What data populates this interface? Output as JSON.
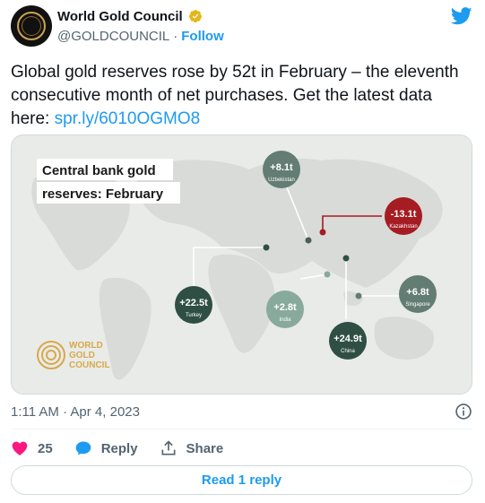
{
  "author": {
    "name": "World Gold Council",
    "handle": "@GOLDCOUNCIL",
    "follow_label": "Follow"
  },
  "tweet": {
    "text": "Global gold reserves rose by 52t in February – the eleventh consecutive month of net purchases. Get the latest data here: ",
    "link": "spr.ly/6010OGMO8"
  },
  "media": {
    "title_line1": "Central bank gold",
    "title_line2": "reserves: February",
    "brand": [
      "WORLD",
      "GOLD",
      "COUNCIL"
    ],
    "bubbles": [
      {
        "value": "+8.1t",
        "country": "Uzbekistan",
        "color": "#637d74"
      },
      {
        "value": "-13.1t",
        "country": "Kazakhstan",
        "color": "#a51c22"
      },
      {
        "value": "+6.8t",
        "country": "Singapore",
        "color": "#637d74"
      },
      {
        "value": "+22.5t",
        "country": "Turkey",
        "color": "#2f4f45"
      },
      {
        "value": "+2.8t",
        "country": "India",
        "color": "#88aa9c"
      },
      {
        "value": "+24.9t",
        "country": "China",
        "color": "#2f4f45"
      }
    ]
  },
  "meta": {
    "timestamp": "1:11 AM · Apr 4, 2023"
  },
  "actions": {
    "likes": "25",
    "reply_label": "Reply",
    "share_label": "Share"
  },
  "read_reply_label": "Read 1 reply",
  "colors": {
    "twitter_blue": "#1d9bf0",
    "like_red": "#f91880",
    "gold": "#c9a34f"
  }
}
